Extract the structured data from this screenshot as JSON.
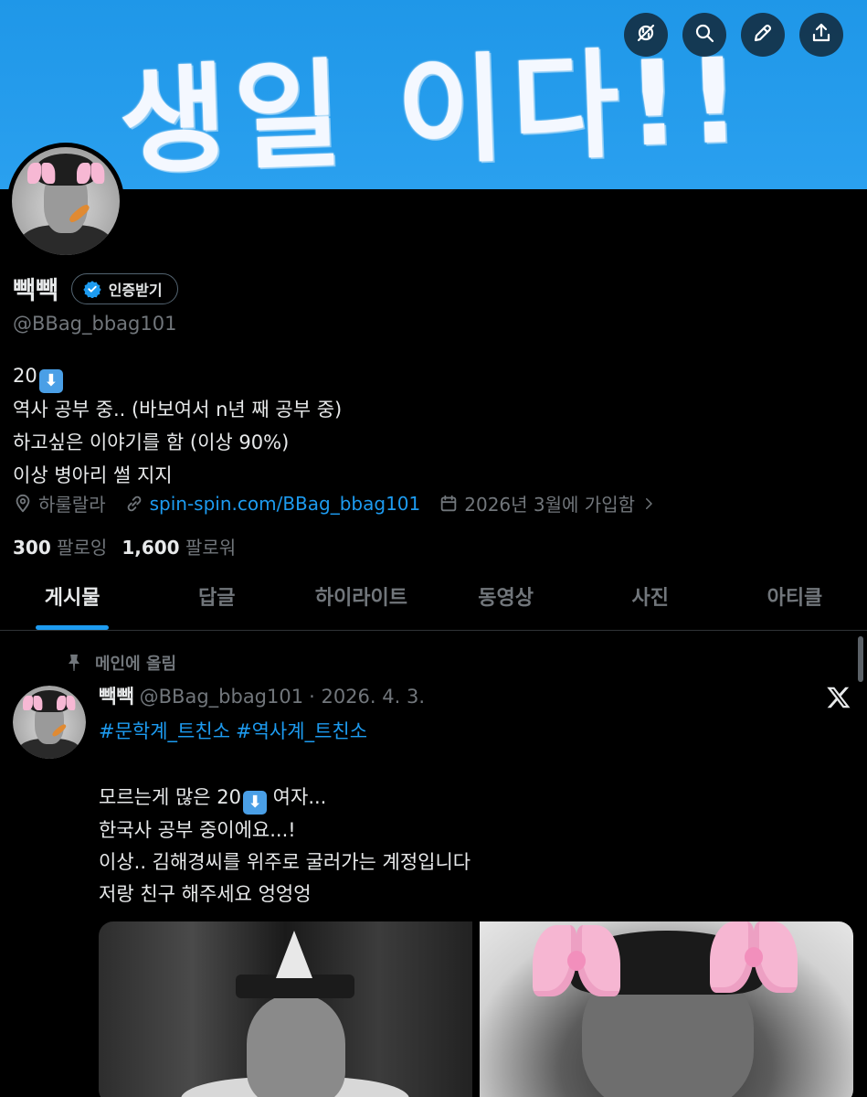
{
  "banner": {
    "text": "생일 이다!!"
  },
  "top_actions": [
    {
      "name": "translate-off-icon"
    },
    {
      "name": "search-icon"
    },
    {
      "name": "edit-icon"
    },
    {
      "name": "share-icon"
    }
  ],
  "profile": {
    "display_name": "빽빽",
    "verify_label": "인증받기",
    "handle": "@BBag_bbag101",
    "bio": {
      "line1_prefix": "20",
      "line1_emoji": "⬇",
      "line2": "역사 공부 중.. (바보여서 n년 째 공부 중)",
      "line3": "하고싶은 이야기를 함 (이상 90%)",
      "line4": "이상 병아리 썰 지지"
    },
    "location": "하룰랄라",
    "website": "spin-spin.com/BBag_bbag101",
    "joined": "2026년 3월에 가입함",
    "following_count": "300",
    "following_label": "팔로잉",
    "followers_count": "1,600",
    "followers_label": "팔로워"
  },
  "tabs": [
    {
      "label": "게시물",
      "active": true
    },
    {
      "label": "답글"
    },
    {
      "label": "하이라이트"
    },
    {
      "label": "동영상"
    },
    {
      "label": "사진"
    },
    {
      "label": "아티클"
    }
  ],
  "pinned_post": {
    "pinned_label": "메인에 올림",
    "author_name": "빽빽",
    "author_handle": "@BBag_bbag101",
    "date": "· 2026. 4. 3.",
    "hashtags": [
      "#문학계_트친소",
      "#역사계_트친소"
    ],
    "body": {
      "line1_prefix": "모르는게 많은 20",
      "line1_emoji": "⬇",
      "line1_suffix": " 여자...",
      "line2": "한국사 공부 중이에요...!",
      "line3": "이상.. 김해경씨를 위주로 굴러가는 계정입니다",
      "line4": "저랑 친구 해주세요 엉엉엉"
    }
  },
  "colors": {
    "banner": "#1f97e8",
    "background": "#000000",
    "accent": "#1d9bf0",
    "muted": "#71767b",
    "text": "#e7e9ea"
  }
}
